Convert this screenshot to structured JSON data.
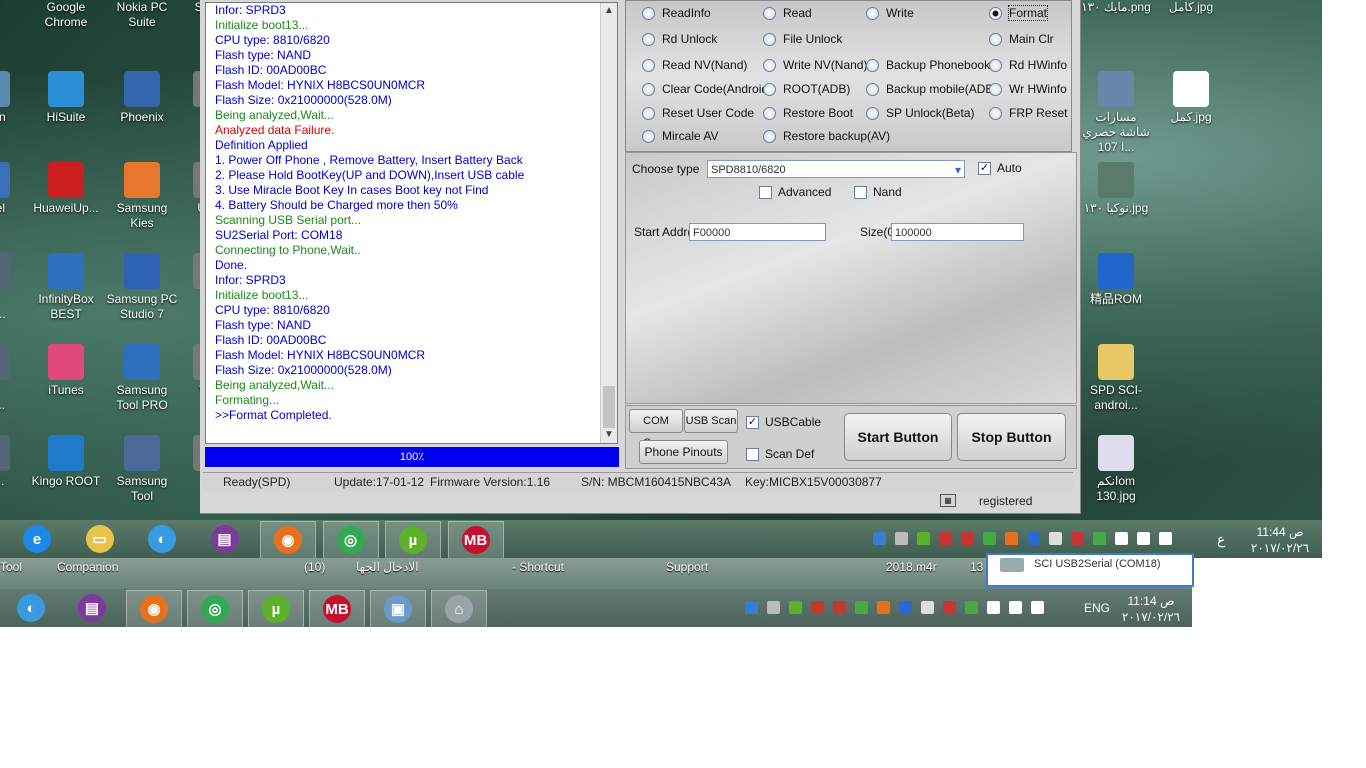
{
  "desktop": {
    "icons_left": [
      {
        "label": "ork",
        "color": "#4a7bc0"
      },
      {
        "label": "Google Chrome",
        "color": "#d9a018"
      },
      {
        "label": "Nokia PC Suite",
        "color": "#2a5ab0"
      },
      {
        "label": "Sc Co",
        "color": "#777777"
      },
      {
        "label": "e Bin",
        "color": "#5a8ab0"
      },
      {
        "label": "HiSuite",
        "color": "#2c8fd6"
      },
      {
        "label": "Phoenix",
        "color": "#3366aa"
      },
      {
        "label": "U",
        "color": "#777777"
      },
      {
        "label": "rol el",
        "color": "#3a70b8"
      },
      {
        "label": "HuaweiUp...",
        "color": "#cc1f1f"
      },
      {
        "label": "Samsung Kies",
        "color": "#e8772e"
      },
      {
        "label": "US F",
        "color": "#777777"
      },
      {
        "label": "t 4 tart...",
        "color": "#556677"
      },
      {
        "label": "InfinityBox BEST",
        "color": "#2f6fbf"
      },
      {
        "label": "Samsung PC Studio 7",
        "color": "#2e62b3"
      },
      {
        "label": "VL",
        "color": "#777777"
      },
      {
        "label": "t 4 ide...",
        "color": "#556677"
      },
      {
        "label": "iTunes",
        "color": "#e0497a"
      },
      {
        "label": "Samsung Tool PRO",
        "color": "#2f6fbf"
      },
      {
        "label": "W D",
        "color": "#777777"
      },
      {
        "label": "eB...",
        "color": "#556677"
      },
      {
        "label": "Kingo ROOT",
        "color": "#1f7ac9"
      },
      {
        "label": "Samsung Tool",
        "color": "#4a6a9a"
      },
      {
        "label": "Co",
        "color": "#777777"
      }
    ],
    "icons_right": [
      {
        "label": "مايك ١٣٠.png",
        "color": "#8aa0c8"
      },
      {
        "label": "كامل.jpg",
        "color": "#dfe6ef"
      },
      {
        "label": "مسارات شاشة حصري ا 107...",
        "color": "#6688aa"
      },
      {
        "label": "كمل.jpg",
        "color": "#ffffff"
      },
      {
        "label": "نوكيا ١٣٠.jpg",
        "color": "#5a7a6a"
      },
      {
        "label": "精品ROM",
        "color": "#2266cc"
      },
      {
        "label": "SPD SCI-androi...",
        "color": "#e8c766"
      },
      {
        "label": "انكمom 130.jpg",
        "color": "#ddddee"
      }
    ]
  },
  "log": {
    "lines": [
      {
        "text": "Infor: SPRD3",
        "color": "#0000cc"
      },
      {
        "text": "Initialize boot13...",
        "color": "#1a8a1a"
      },
      {
        "text": "CPU   type: 8810/6820",
        "color": "#0000cc"
      },
      {
        "text": "Flash  type: NAND",
        "color": "#0000cc"
      },
      {
        "text": "Flash    ID: 00AD00BC",
        "color": "#0000cc"
      },
      {
        "text": "Flash Model: HYNIX H8BCS0UN0MCR",
        "color": "#0000cc"
      },
      {
        "text": "Flash  Size: 0x21000000(528.0M)",
        "color": "#0000cc"
      },
      {
        "text": "Being analyzed,Wait...",
        "color": "#1a8a1a"
      },
      {
        "text": "Analyzed data Failure.",
        "color": "#dd0000"
      },
      {
        "text": "Definition Applied",
        "color": "#0000cc"
      },
      {
        "text": "1. Power Off Phone , Remove Battery, Insert Battery Back",
        "color": "#0000cc"
      },
      {
        "text": "2. Please Hold BootKey(UP and DOWN),Insert USB cable",
        "color": "#0000cc"
      },
      {
        "text": "3. Use Miracle Boot Key In cases Boot key not Find",
        "color": "#0000cc"
      },
      {
        "text": "4. Battery Should be Charged more then 50%",
        "color": "#0000cc"
      },
      {
        "text": "Scanning USB Serial port...",
        "color": "#1a8a1a"
      },
      {
        "text": "SU2Serial Port: COM18",
        "color": "#0000cc"
      },
      {
        "text": "Connecting to Phone,Wait..",
        "color": "#1a8a1a"
      },
      {
        "text": "Done.",
        "color": "#0000cc"
      },
      {
        "text": "Infor: SPRD3",
        "color": "#0000cc"
      },
      {
        "text": "Initialize boot13...",
        "color": "#1a8a1a"
      },
      {
        "text": "CPU   type: 8810/6820",
        "color": "#0000cc"
      },
      {
        "text": "Flash  type: NAND",
        "color": "#0000cc"
      },
      {
        "text": "Flash    ID: 00AD00BC",
        "color": "#0000cc"
      },
      {
        "text": "Flash Model: HYNIX H8BCS0UN0MCR",
        "color": "#0000cc"
      },
      {
        "text": "Flash  Size: 0x21000000(528.0M)",
        "color": "#0000cc"
      },
      {
        "text": "Being analyzed,Wait...",
        "color": "#1a8a1a"
      },
      {
        "text": "Formating...",
        "color": "#1a8a1a"
      },
      {
        "text": ">>Format Completed.",
        "color": "#0000cc"
      }
    ]
  },
  "progress": {
    "label": "100٪",
    "value": 1.0,
    "color": "#0000ee"
  },
  "status": {
    "mode": "Ready(SPD)",
    "update": "Update:17-01-12",
    "firmware": "Firmware Version:1.16",
    "serial": "S/N: MBCM160415NBC43A",
    "key": "Key:MICBX15V00030877",
    "registered": "registered"
  },
  "operations": [
    {
      "label": "ReadInfo",
      "selected": false
    },
    {
      "label": "Read",
      "selected": false
    },
    {
      "label": "Write",
      "selected": false
    },
    {
      "label": "Format",
      "selected": true
    },
    {
      "label": "Rd Unlock",
      "selected": false
    },
    {
      "label": "File Unlock",
      "selected": false
    },
    {
      "label": "Main Clr",
      "selected": false
    },
    {
      "label": "Read NV(Nand)",
      "selected": false
    },
    {
      "label": "Write NV(Nand)",
      "selected": false
    },
    {
      "label": "Backup Phonebook",
      "selected": false
    },
    {
      "label": "Rd HWinfo",
      "selected": false
    },
    {
      "label": "Clear Code(Android)",
      "selected": false
    },
    {
      "label": "ROOT(ADB)",
      "selected": false
    },
    {
      "label": "Backup mobile(ADB)",
      "selected": false
    },
    {
      "label": "Wr HWinfo",
      "selected": false
    },
    {
      "label": "Reset User Code",
      "selected": false
    },
    {
      "label": "Restore Boot",
      "selected": false
    },
    {
      "label": "SP Unlock(Beta)",
      "selected": false
    },
    {
      "label": "FRP Reset",
      "selected": false
    },
    {
      "label": "Mircale AV",
      "selected": false
    },
    {
      "label": "Restore backup(AV)",
      "selected": false
    }
  ],
  "config": {
    "choose_type_label": "Choose  type",
    "choose_type_value": "SPD8810/6820",
    "auto_label": "Auto",
    "auto_checked": true,
    "advanced_label": "Advanced",
    "nand_label": "Nand",
    "start_addr_label": "Start Addr(0",
    "start_addr_value": "F00000",
    "size_label": "Size(0",
    "size_value": "100000"
  },
  "buttons": {
    "com_scan": "COM Scan",
    "usb_scan": "USB Scan",
    "usb_cable": "USBCable",
    "usb_cable_checked": true,
    "phone_pinouts": "Phone Pinouts",
    "scan_def": "Scan Def",
    "start": "Start Button",
    "stop": "Stop Button"
  },
  "taskbar_top": {
    "apps": [
      {
        "name": "ie-icon",
        "color": "#1e88e5",
        "glyph": "e"
      },
      {
        "name": "explorer-icon",
        "color": "#e8c24a",
        "glyph": "▭"
      },
      {
        "name": "app-icon",
        "color": "#3a9ae0",
        "glyph": "◐"
      },
      {
        "name": "winrar-icon",
        "color": "#7b3a9c",
        "glyph": "▤"
      },
      {
        "name": "firefox-icon",
        "color": "#e8701a",
        "glyph": "◉"
      },
      {
        "name": "chrome-icon",
        "color": "#34a853",
        "glyph": "◎"
      },
      {
        "name": "utorrent-icon",
        "color": "#5cb02a",
        "glyph": "µ"
      },
      {
        "name": "miracle-icon",
        "color": "#c8102e",
        "glyph": "MB"
      }
    ],
    "clock_time": "11:44 ص",
    "clock_date": "٢٠١٧/٠٢/٢٦",
    "lang": "ع"
  },
  "taskbar_bottom": {
    "strip_items": [
      "Tool",
      "Companion",
      "(10)",
      "الادخال الجها",
      "- Shortcut",
      "Support",
      "2018.m4r",
      "13"
    ],
    "popup_text": "SCI USB2Serial (COM18)",
    "apps": [
      {
        "name": "app-icon",
        "color": "#3a9ae0",
        "glyph": "◐"
      },
      {
        "name": "winrar-icon",
        "color": "#7b3a9c",
        "glyph": "▤"
      },
      {
        "name": "firefox-icon",
        "color": "#e8701a",
        "glyph": "◉"
      },
      {
        "name": "chrome-icon",
        "color": "#34a853",
        "glyph": "◎"
      },
      {
        "name": "utorrent-icon",
        "color": "#5cb02a",
        "glyph": "µ"
      },
      {
        "name": "miracle-icon",
        "color": "#c8102e",
        "glyph": "MB"
      },
      {
        "name": "network-settings-icon",
        "color": "#6a9ac8",
        "glyph": "▣"
      },
      {
        "name": "usb-device-icon",
        "color": "#9aa4a8",
        "glyph": "⌂"
      }
    ],
    "clock_time": "11:14 ص",
    "clock_date": "٢٠١٧/٠٢/٢٦",
    "lang": "ENG"
  }
}
